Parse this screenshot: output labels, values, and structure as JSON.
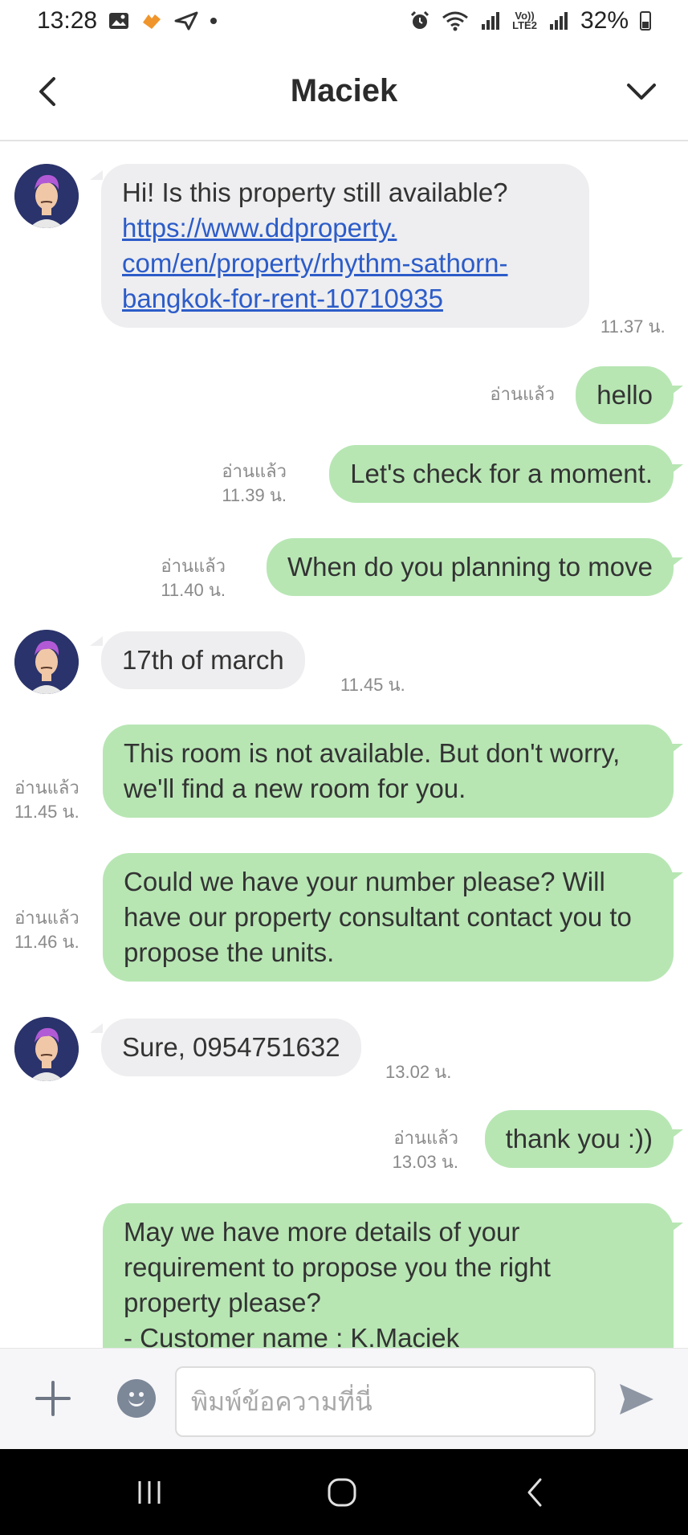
{
  "status_bar": {
    "time": "13:28",
    "battery": "32%",
    "network": "LTE2"
  },
  "header": {
    "title": "Maciek"
  },
  "contact": {
    "avatar_colors": {
      "hair": "#b25ad6",
      "face": "#f0c8a8",
      "background": "#2a336b"
    }
  },
  "messages": [
    {
      "side": "in",
      "text_before": "Hi! Is this property still available? ",
      "link": "https://www.ddproperty.com/en/property/rhythm-sathorn-bangkok-for-rent-10710935",
      "link_lines": [
        "https://www.ddproperty.",
        "com/en/property/rhythm-sathorn-",
        "bangkok-for-rent-10710935"
      ],
      "time": "11.37 น."
    },
    {
      "side": "out",
      "text": "hello",
      "read": "อ่านแล้ว",
      "time": ""
    },
    {
      "side": "out",
      "text": "Let's check for a moment.",
      "read": "อ่านแล้ว",
      "time": "11.39 น."
    },
    {
      "side": "out",
      "text": "When do you planning to move",
      "read": "อ่านแล้ว",
      "time": "11.40 น."
    },
    {
      "side": "in",
      "text": "17th of march",
      "time": "11.45 น."
    },
    {
      "side": "out",
      "text": "This room is not available.  But don't worry, we'll find a new room for you.",
      "read": "อ่านแล้ว",
      "time": "11.45 น."
    },
    {
      "side": "out",
      "text": "Could we have your number please? Will have our property consultant contact you to propose the units.",
      "read": "อ่านแล้ว",
      "time": "11.46 น."
    },
    {
      "side": "in",
      "text": "Sure, 0954751632",
      "time": "13.02 น."
    },
    {
      "side": "out",
      "text": "thank you :))",
      "read": "อ่านแล้ว",
      "time": "13.03 น."
    },
    {
      "side": "out",
      "text": "May we have more details of your requirement to propose you the right property please?",
      "text_cut": "- Customer name : K.Maciek",
      "read": "",
      "time": ""
    }
  ],
  "input": {
    "placeholder": "พิมพ์ข้อความที่นี่"
  },
  "icons": {
    "back": "chevron-left-icon",
    "menu": "chevron-down-icon",
    "plus": "plus-icon",
    "emoji": "emoji-icon",
    "send": "send-icon",
    "nav_recents": "recents-icon",
    "nav_home": "home-icon",
    "nav_back": "back-icon"
  },
  "colors": {
    "outgoing_bubble": "#b7e6b3",
    "incoming_bubble": "#eeeef0",
    "link": "#2c5cc9"
  }
}
